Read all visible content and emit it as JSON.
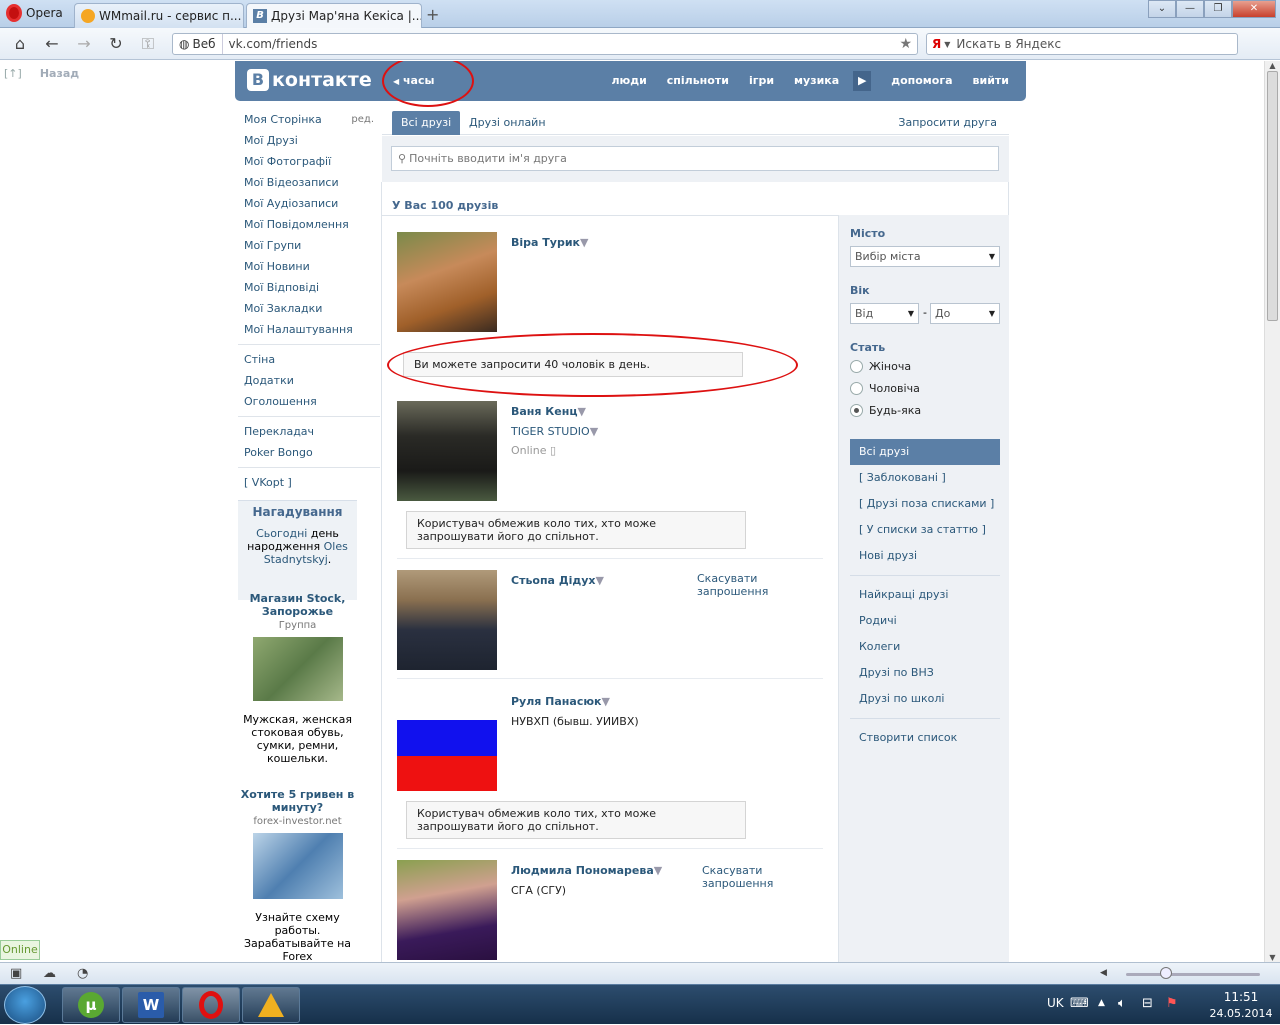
{
  "browser": {
    "menu_label": "Opera",
    "tabs": [
      {
        "title": "WMmail.ru - сервис п..."
      },
      {
        "title": "Друзі Мар'яна Кекіса |..."
      }
    ],
    "address_mode": "Веб",
    "url": "vk.com/friends",
    "search_placeholder": "Искать в Яндекс",
    "back_label": "Назад",
    "back_hotkey": "[↑]"
  },
  "vk": {
    "logo_text": "контакте",
    "logo_letter": "В",
    "status": "часы",
    "menu": [
      "люди",
      "спільноти",
      "ігри",
      "музика",
      "допомога",
      "вийти"
    ]
  },
  "left_menu": {
    "group1": [
      {
        "label": "Моя Сторінка",
        "extra": "ред."
      },
      {
        "label": "Мої Друзі"
      },
      {
        "label": "Мої Фотографії"
      },
      {
        "label": "Мої Відеозаписи"
      },
      {
        "label": "Мої Аудіозаписи"
      },
      {
        "label": "Мої Повідомлення"
      },
      {
        "label": "Мої Групи"
      },
      {
        "label": "Мої Новини"
      },
      {
        "label": "Мої Відповіді"
      },
      {
        "label": "Мої Закладки"
      },
      {
        "label": "Мої Налаштування"
      }
    ],
    "group2": [
      "Стіна",
      "Додатки",
      "Оголошення"
    ],
    "group3": [
      "Перекладач",
      "Poker Bongo"
    ],
    "group4": [
      "[ VKopt ]"
    ]
  },
  "reminder": {
    "title": "Нагадування",
    "today": "Сьогодні",
    "text": "день народження",
    "person": "Oles Stadnytskyj",
    "end": "."
  },
  "ads": [
    {
      "title": "Магазин Stock, Запорожье",
      "sub": "Группа",
      "text": "Мужская, женская стоковая обувь, сумки, ремни, кошельки."
    },
    {
      "title": "Хотите 5 гривен в минуту?",
      "sub": "forex-investor.net",
      "text": "Узнайте схему работы. Зарабатывайте на Forex автоматически."
    }
  ],
  "friends_tabs": {
    "all": "Всі друзі",
    "online": "Друзі онлайн",
    "invite": "Запросити друга"
  },
  "search_placeholder": "Почніть вводити ім'я друга",
  "count_text": "У Вас 100 друзів",
  "friends": [
    {
      "name": "Віра Турик",
      "notice": "Ви можете запросити 40 чоловік в день."
    },
    {
      "name": "Ваня Кенц",
      "sub": "TIGER STUDIO",
      "online": "Online",
      "notice": "Користувач обмежив коло тих, хто може запрошувати його до спільнот."
    },
    {
      "name": "Стьопа Дідух",
      "cancel": "Скасувати запрошення"
    },
    {
      "name": "Руля Панасюк",
      "sub": "НУВХП (бывш. УИИВХ)",
      "notice": "Користувач обмежив коло тих, хто може запрошувати його до спільнот."
    },
    {
      "name": "Людмила Пономарева",
      "sub": "СГА (СГУ)",
      "cancel": "Скасувати запрошення"
    }
  ],
  "filters": {
    "city_label": "Місто",
    "city_value": "Вибір міста",
    "age_label": "Вік",
    "age_from": "Від",
    "age_dash": "-",
    "age_to": "До",
    "sex_label": "Стать",
    "sex_options": [
      "Жіноча",
      "Чоловіча",
      "Будь-яка"
    ],
    "sex_selected": "Будь-яка",
    "lists1": [
      "Всі друзі",
      "[ Заблоковані ]",
      "[ Друзі поза списками ]",
      "[ У списки за статтю ]",
      "Нові друзі"
    ],
    "lists2": [
      "Найкращі друзі",
      "Родичі",
      "Колеги",
      "Друзі по ВНЗ",
      "Друзі по школі"
    ],
    "create": "Створити список"
  },
  "online_badge": "Online",
  "tray": {
    "lang": "UK",
    "time": "11:51",
    "date": "24.05.2014"
  },
  "colors": {
    "vk_blue": "#5b7fa6",
    "link": "#2b587a",
    "annotation_red": "#dd1111"
  }
}
